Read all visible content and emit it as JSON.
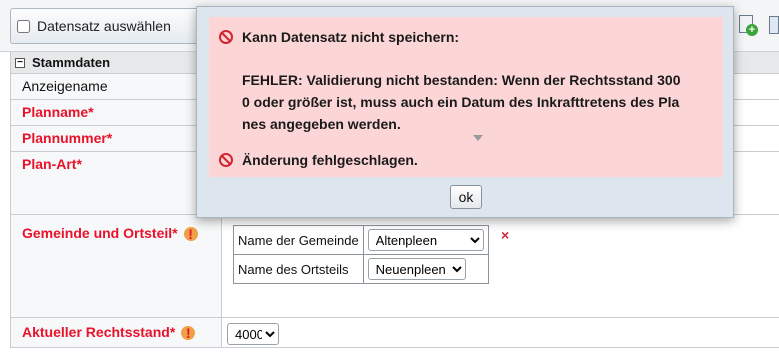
{
  "header": {
    "select_record_label": "Datensatz auswählen"
  },
  "section": {
    "title": "Stammdaten",
    "collapse_symbol": "−"
  },
  "fields": {
    "display_name": "Anzeigename",
    "plan_name": "Planname*",
    "plan_number": "Plannummer*",
    "plan_type": "Plan-Art*",
    "municipality": "Gemeinde und Ortsteil*",
    "legal_status": "Aktueller Rechtsstand*"
  },
  "municipality_table": {
    "municipality_label": "Name der Gemeinde",
    "municipality_value": "Altenpleen",
    "district_label": "Name des Ortsteils",
    "district_value": "Neuenpleen",
    "remove_symbol": "×"
  },
  "legal_status_value": "4000",
  "info_symbol": "!",
  "dialog": {
    "title": "Kann Datensatz nicht speichern:",
    "error_line1": "FEHLER: Validierung nicht bestanden: Wenn der Rechtsstand 300",
    "error_line2": "0 oder größer ist, muss auch ein Datum des Inkrafttretens des Pla",
    "error_line3": "nes angegeben werden.",
    "failure": "Änderung fehlgeschlagen.",
    "ok_label": "ok"
  },
  "icons": {
    "error": "forbidden-icon",
    "add_record": "add-document-icon",
    "next_tool": "document-icon"
  },
  "colors": {
    "required_label": "#e8122a",
    "error_background": "#fcd6d6",
    "error_icon": "#d0262f",
    "info_badge": "#f0a046"
  }
}
